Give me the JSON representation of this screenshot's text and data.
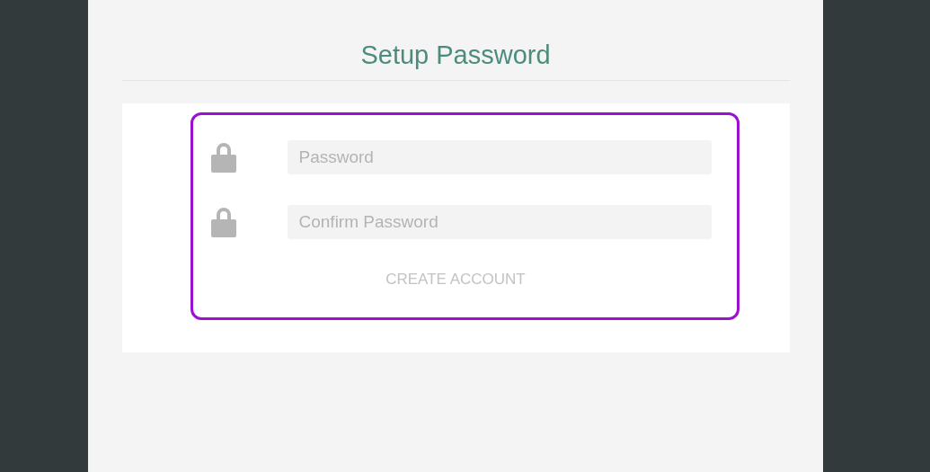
{
  "title": "Setup Password",
  "fields": [
    {
      "placeholder": "Password"
    },
    {
      "placeholder": "Confirm Password"
    }
  ],
  "submit_button": {
    "label": "CREATE ACCOUNT"
  }
}
